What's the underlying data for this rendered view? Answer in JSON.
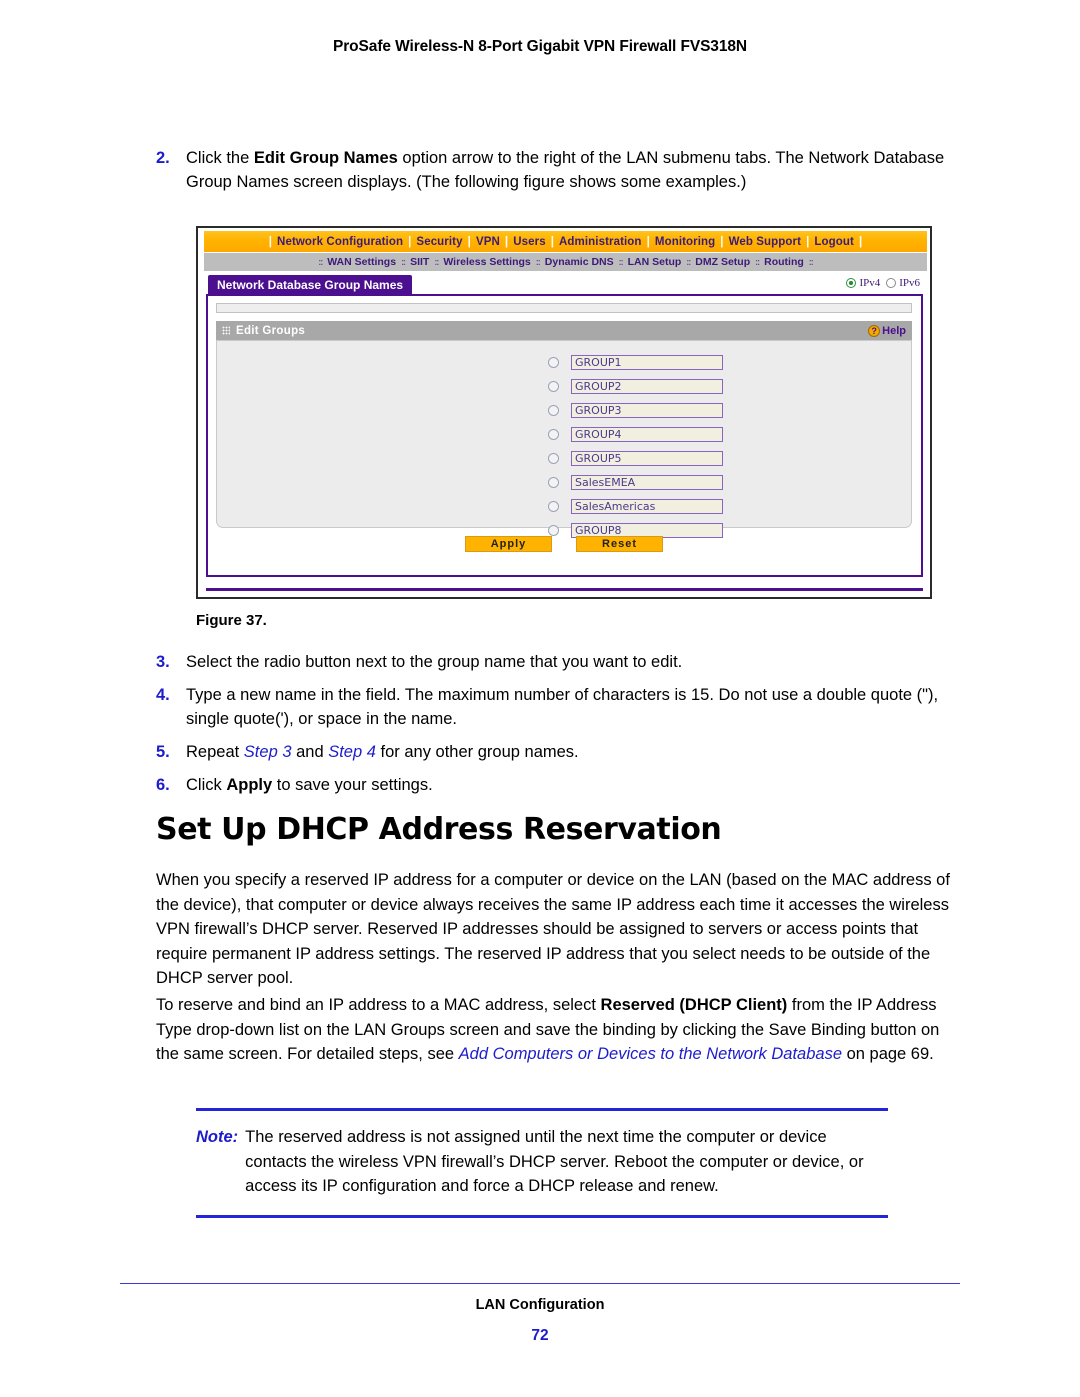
{
  "running_header": "ProSafe Wireless-N 8-Port Gigabit VPN Firewall FVS318N",
  "steps_top": {
    "number": "2.",
    "text_1": "Click the ",
    "bold_1": "Edit Group Names",
    "text_2": " option arrow to the right of the LAN submenu tabs. The Network Database Group Names screen displays. (The following figure shows some examples.)"
  },
  "figure": {
    "caption": "Figure 37.",
    "nav_main": {
      "items": [
        "Network Configuration",
        "Security",
        "VPN",
        "Users",
        "Administration",
        "Monitoring",
        "Web Support",
        "Logout"
      ],
      "separator": "|"
    },
    "nav_sub": {
      "items": [
        "WAN Settings",
        "SIIT",
        "Wireless Settings",
        "Dynamic DNS",
        "LAN Setup",
        "DMZ Setup",
        "Routing"
      ],
      "separator": "::"
    },
    "page_tab": "Network Database Group Names",
    "ip_stack": {
      "ipv4_label": "IPv4",
      "ipv6_label": "IPv6",
      "selected": "IPv4"
    },
    "section": {
      "title": "Edit Groups",
      "help_label": "Help",
      "help_icon_glyph": "?"
    },
    "groups": [
      {
        "name": "GROUP1",
        "selected": false
      },
      {
        "name": "GROUP2",
        "selected": false
      },
      {
        "name": "GROUP3",
        "selected": false
      },
      {
        "name": "GROUP4",
        "selected": false
      },
      {
        "name": "GROUP5",
        "selected": false
      },
      {
        "name": "SalesEMEA",
        "selected": false
      },
      {
        "name": "SalesAmericas",
        "selected": false
      },
      {
        "name": "GROUP8",
        "selected": false
      }
    ],
    "buttons": {
      "apply": "Apply",
      "reset": "Reset"
    },
    "colors": {
      "nav_main_bg": "#ffb300",
      "nav_sub_bg": "#bdbdbd",
      "tab_bg": "#4b0f8f",
      "section_head_bg": "#a8a8a8",
      "button_bg": "#ffb300",
      "field_border": "#8a64c0",
      "field_bg": "#f0efe0"
    }
  },
  "steps_bottom": [
    {
      "number": "3.",
      "text": "Select the radio button next to the group name that you want to edit."
    },
    {
      "number": "4.",
      "text": "Type a new name in the field. The maximum number of characters is 15. Do not use a double quote (\"), single quote('), or space in the name."
    },
    {
      "number": "5.",
      "prefix": "Repeat ",
      "xref_1": "Step 3",
      "middle": " and ",
      "xref_2": "Step 4",
      "suffix": " for any other group names."
    },
    {
      "number": "6.",
      "prefix": "Click ",
      "bold": "Apply",
      "suffix": " to save your settings."
    }
  ],
  "heading": "Set Up DHCP Address Reservation",
  "paragraph_1": "When you specify a reserved IP address for a computer or device on the LAN (based on the MAC address of the device), that computer or device always receives the same IP address each time it accesses the wireless VPN firewall’s DHCP server. Reserved IP addresses should be assigned to servers or access points that require permanent IP address settings. The reserved IP address that you select needs to be outside of the DHCP server pool.",
  "paragraph_2": {
    "text_1": "To reserve and bind an IP address to a MAC address, select ",
    "bold_1": "Reserved (DHCP Client)",
    "text_2": " from the IP Address Type drop-down list on the LAN Groups screen and save the binding by clicking the Save Binding button on the same screen. For detailed steps, see ",
    "xref": "Add Computers or Devices to the Network Database",
    "text_3": " on page 69."
  },
  "note": {
    "label": "Note:",
    "text": "The reserved address is not assigned until the next time the computer or device contacts the wireless VPN firewall’s DHCP server. Reboot the computer or device, or access its IP configuration and force a DHCP release and renew."
  },
  "footer": {
    "title": "LAN Configuration",
    "page_number": "72"
  }
}
